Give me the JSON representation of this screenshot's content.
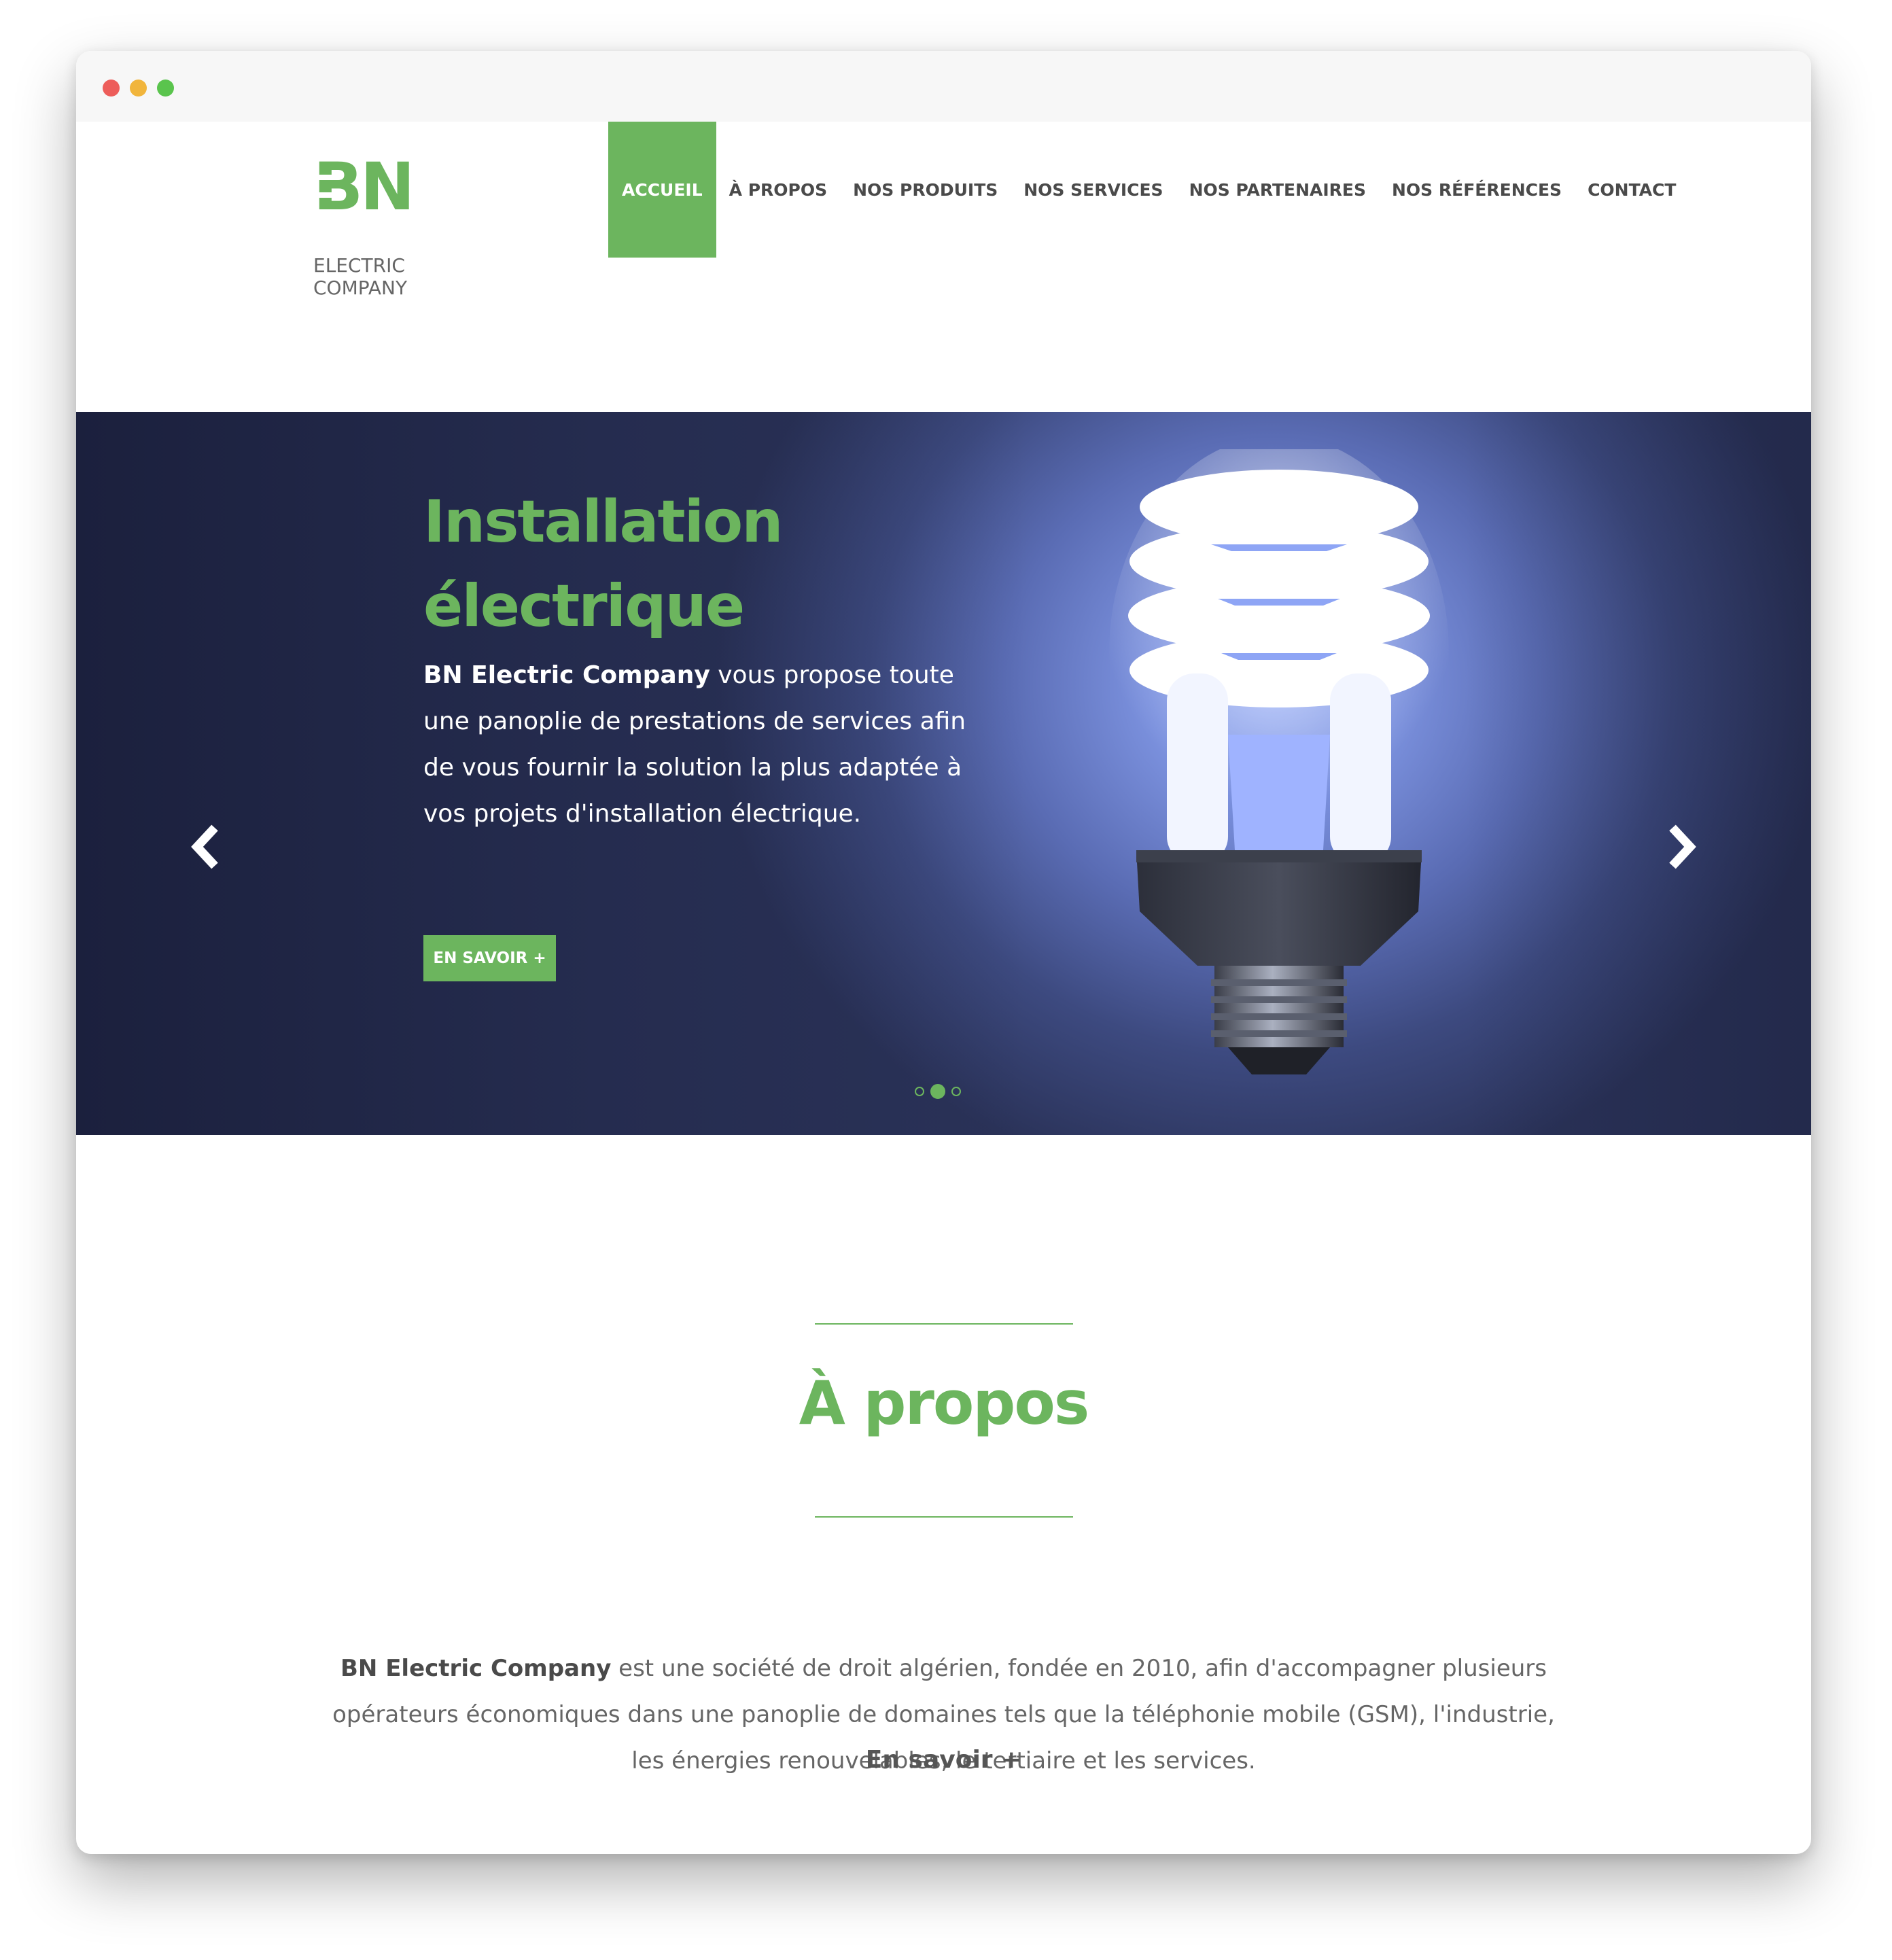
{
  "brand": {
    "logo_mark": "BN",
    "logo_line1": "ELECTRIC",
    "logo_line2": "COMPANY",
    "accent_color": "#6cb55e"
  },
  "nav": {
    "items": [
      {
        "label": "ACCUEIL",
        "active": true
      },
      {
        "label": "À PROPOS",
        "active": false
      },
      {
        "label": "NOS PRODUITS",
        "active": false
      },
      {
        "label": "NOS SERVICES",
        "active": false
      },
      {
        "label": "NOS PARTENAIRES",
        "active": false
      },
      {
        "label": "NOS RÉFÉRENCES",
        "active": false
      },
      {
        "label": "CONTACT",
        "active": false
      }
    ]
  },
  "hero": {
    "title_line1": "Installation",
    "title_line2": "électrique",
    "text_strong": "BN Electric Company",
    "text_rest": " vous propose toute une panoplie de prestations de services afin de vous fournir la solution la plus adaptée à vos projets d'installation électrique.",
    "button_label": "EN SAVOIR +",
    "slide_count": 3,
    "active_slide": 2,
    "prev_icon": "chevron-left-icon",
    "next_icon": "chevron-right-icon"
  },
  "about": {
    "title": "À propos",
    "text_strong": "BN Electric Company",
    "text_rest": " est une société de droit algérien, fondée en 2010, afin d'accompagner plusieurs opérateurs économiques dans une panoplie de domaines tels que la téléphonie mobile (GSM), l'industrie, les énergies renouvelables, le tertiaire et les services.",
    "link_label": "En savoir +"
  }
}
